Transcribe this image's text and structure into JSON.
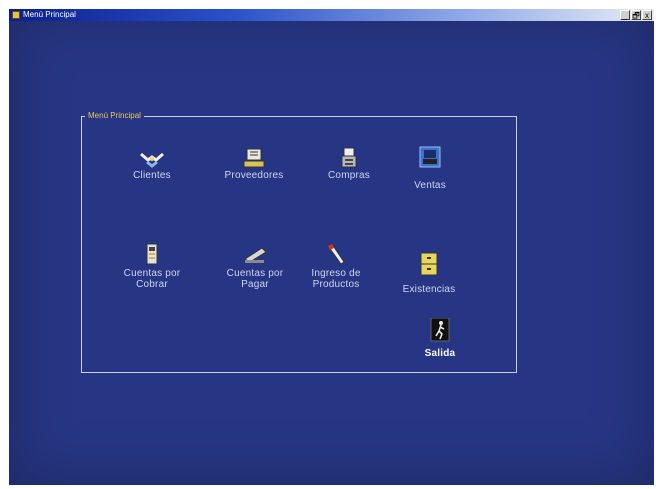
{
  "window": {
    "title": "Menú Principal",
    "controls": [
      "_",
      "🗗",
      "x"
    ]
  },
  "menu": {
    "legend": "Menú Principal",
    "items": [
      {
        "label": "Clientes",
        "icon": "handshake-icon"
      },
      {
        "label": "Proveedores",
        "icon": "cash-register-icon"
      },
      {
        "label": "Compras",
        "icon": "printer-receipt-icon"
      },
      {
        "label": "Ventas",
        "icon": "sales-terminal-icon"
      },
      {
        "label": "Cuentas por Cobrar",
        "icon": "accounts-receivable-icon"
      },
      {
        "label": "Cuentas por Pagar",
        "icon": "stapler-icon"
      },
      {
        "label": "Ingreso de Productos",
        "icon": "pen-icon"
      },
      {
        "label": "Existencias",
        "icon": "file-cabinet-icon"
      },
      {
        "label": "Salida",
        "icon": "exit-icon"
      }
    ]
  },
  "colors": {
    "background": "#273684",
    "frame": "#c9cfe8",
    "legend": "#e8c75a",
    "label": "#cfd5ef"
  }
}
